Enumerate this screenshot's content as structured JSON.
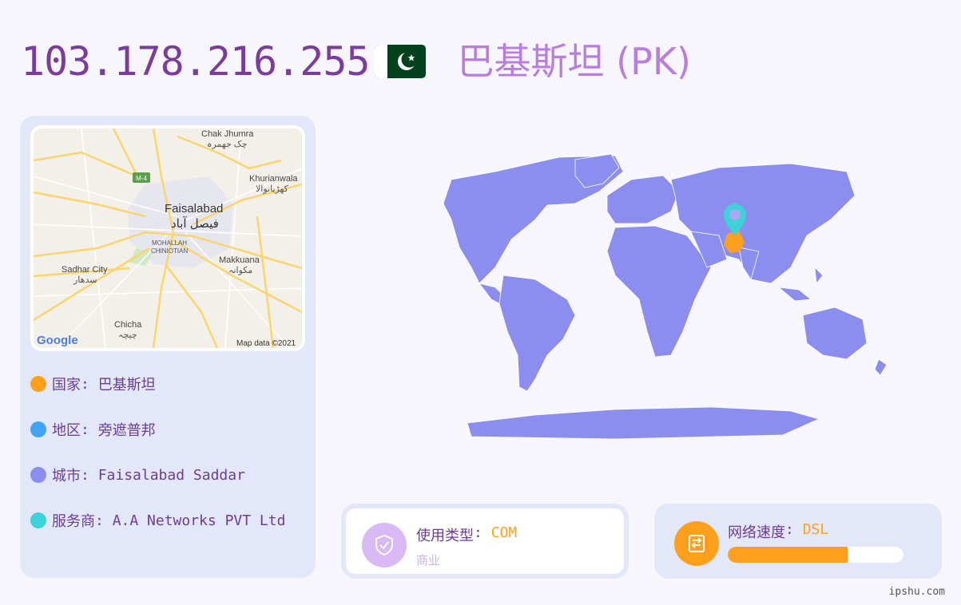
{
  "header": {
    "ip": "103.178.216.255",
    "flag_icon": "pakistan-flag-icon",
    "country_title": "巴基斯坦 (PK)"
  },
  "map": {
    "labels": {
      "chak_jhumra": "Chak Jhumra",
      "chak_jhumra_ur": "چک جھمرہ",
      "khurianwala": "Khurianwala",
      "khurianwala_ur": "کھڑیانوالا",
      "m4": "M-4",
      "faisalabad": "Faisalabad",
      "faisalabad_ur": "فیصل آباد",
      "mohallah": "MOHALLAH",
      "chiniotian": "CHINIOTIAN",
      "sadhar": "Sadhar City",
      "sadhar_ur": "سدھار",
      "makkuana": "Makkuana",
      "makkuana_ur": "مکوانہ",
      "chicha": "Chicha",
      "chicha_ur": "چیچہ",
      "google": "Google",
      "attribution": "Map data ©2021"
    }
  },
  "info": [
    {
      "label": "国家",
      "value": "巴基斯坦",
      "color": "#ff9f1c"
    },
    {
      "label": "地区",
      "value": "旁遮普邦",
      "color": "#3fa4f4"
    },
    {
      "label": "城市",
      "value": "Faisalabad Saddar",
      "color": "#8b8def"
    },
    {
      "label": "服务商",
      "value": "A.A Networks PVT Ltd",
      "color": "#3bd3d8"
    }
  ],
  "usage": {
    "label": "使用类型",
    "value": "COM",
    "sub": "商业",
    "icon": "shield-check-icon"
  },
  "speed": {
    "label": "网络速度",
    "value": "DSL",
    "icon": "router-icon",
    "level": 0.68
  },
  "colors": {
    "accent_orange": "#ff9f1c",
    "land": "#8b8def",
    "pin": "#3bd3d8",
    "ip_text": "#7a3d9c"
  },
  "watermark": "ipshu.com"
}
